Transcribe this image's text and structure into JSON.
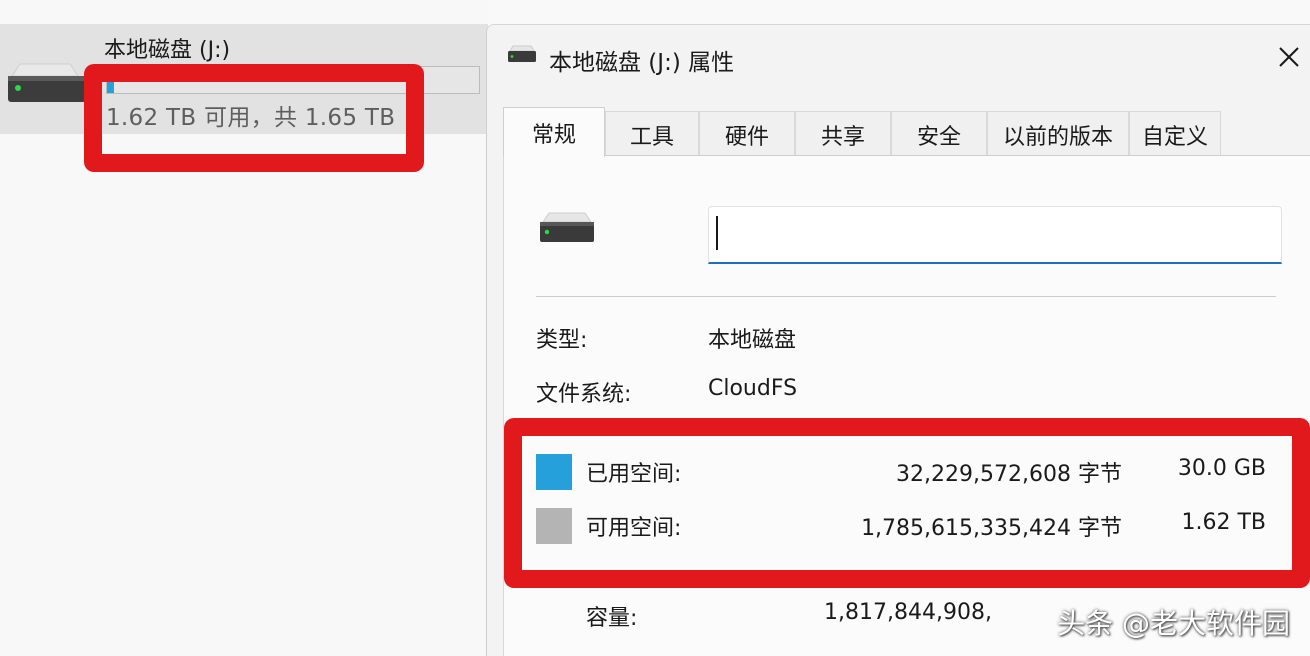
{
  "explorer": {
    "drive_tile": {
      "name": "本地磁盘 (J:)",
      "free_text": "1.62 TB 可用，共 1.65 TB",
      "used_fraction": 0.018,
      "bar_color": "#26a0da",
      "icon": "hard-drive-icon"
    }
  },
  "dialog": {
    "title": "本地磁盘 (J:) 属性",
    "title_icon": "hard-drive-icon",
    "close_icon": "close-icon",
    "tabs": [
      {
        "label": "常规",
        "active": true
      },
      {
        "label": "工具"
      },
      {
        "label": "硬件"
      },
      {
        "label": "共享"
      },
      {
        "label": "安全"
      },
      {
        "label": "以前的版本"
      },
      {
        "label": "自定义"
      }
    ],
    "general": {
      "name_value": "",
      "type_label": "类型:",
      "type_value": "本地磁盘",
      "fs_label": "文件系统:",
      "fs_value": "CloudFS",
      "used": {
        "label": "已用空间:",
        "bytes": "32,229,572,608 字节",
        "human": "30.0 GB",
        "color": "#26a0da"
      },
      "free": {
        "label": "可用空间:",
        "bytes": "1,785,615,335,424 字节",
        "human": "1.62 TB",
        "color": "#b4b4b4"
      },
      "capacity": {
        "label": "容量:",
        "bytes": "1,817,844,908,"
      }
    }
  },
  "annotations": {
    "highlight_color": "#e1191d"
  },
  "watermark": "头条 @老大软件园"
}
